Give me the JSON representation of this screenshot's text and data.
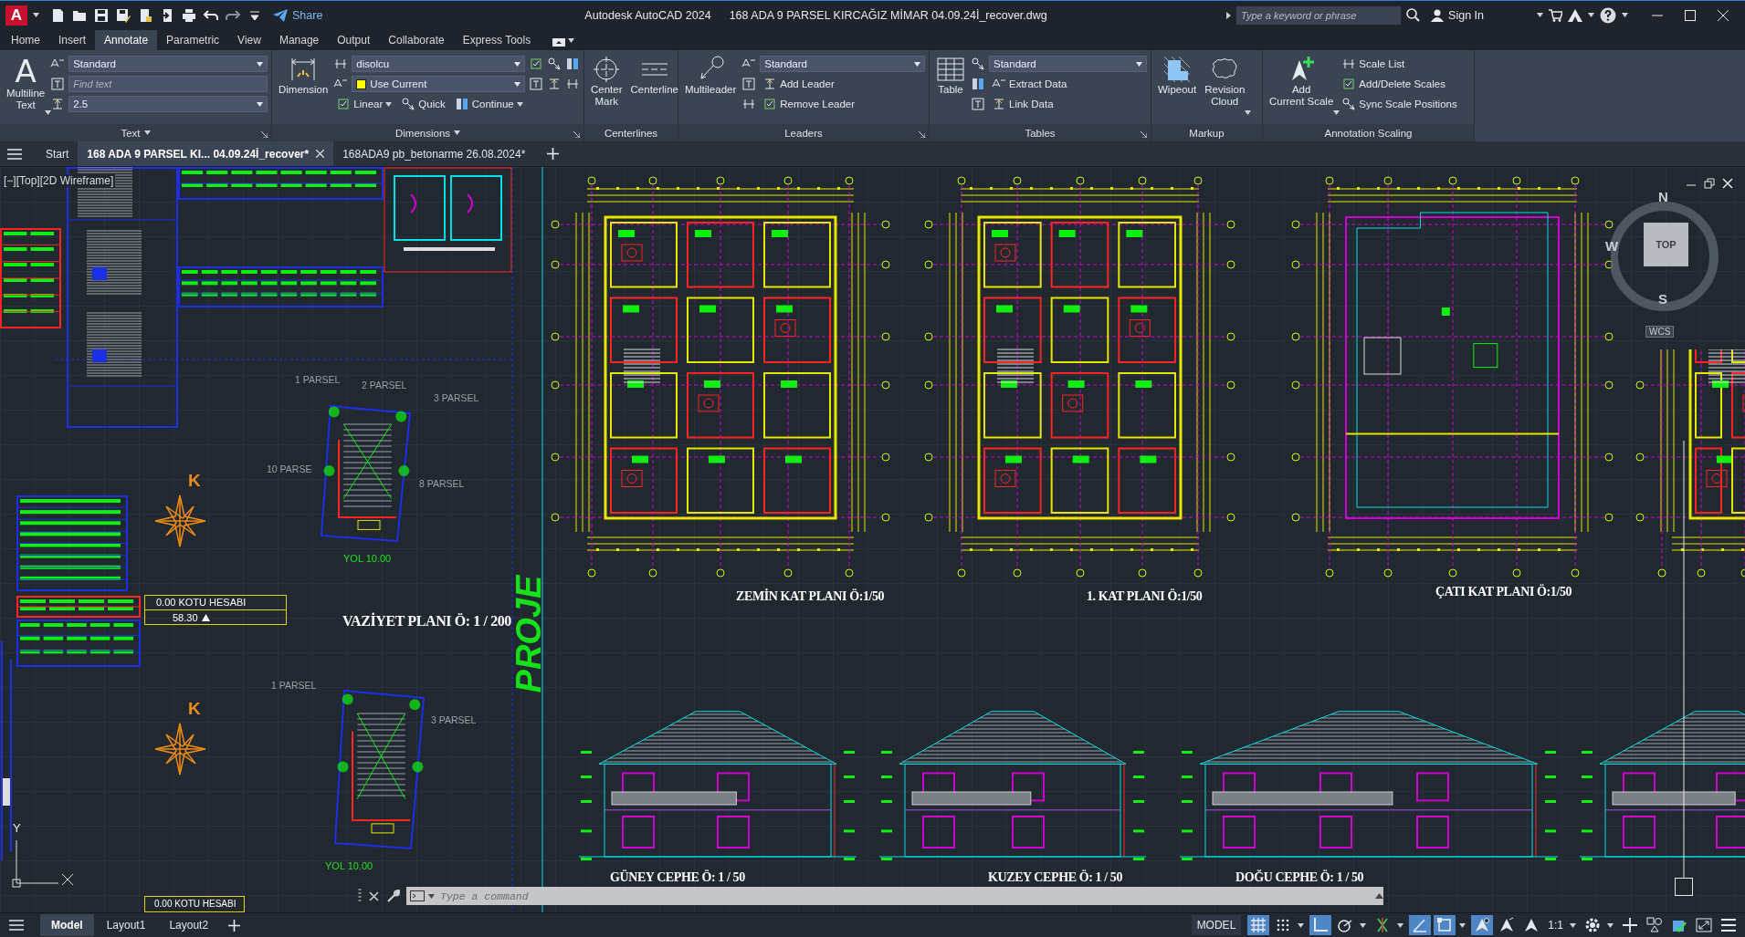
{
  "title_bar": {
    "app_logo": "A",
    "share": "Share",
    "app_name": "Autodesk AutoCAD 2024",
    "file_name": "168 ADA 9 PARSEL KIRCAĞIZ MİMAR 04.09.24İ_recover.dwg",
    "search_placeholder": "Type a keyword or phrase",
    "sign_in": "Sign In"
  },
  "ribbon_tabs": [
    {
      "label": "Home",
      "selected": false
    },
    {
      "label": "Insert",
      "selected": false
    },
    {
      "label": "Annotate",
      "selected": true
    },
    {
      "label": "Parametric",
      "selected": false
    },
    {
      "label": "View",
      "selected": false
    },
    {
      "label": "Manage",
      "selected": false
    },
    {
      "label": "Output",
      "selected": false
    },
    {
      "label": "Collaborate",
      "selected": false
    },
    {
      "label": "Express Tools",
      "selected": false
    }
  ],
  "ribbon_panels": [
    {
      "title": "Text",
      "title_caret": true,
      "launcher": true,
      "large": [
        {
          "glyph": "A",
          "label": "Multiline\nText",
          "caret": true
        }
      ],
      "rows": [
        {
          "kind": "dropdown",
          "value": "Standard"
        },
        {
          "kind": "search",
          "placeholder": "Find text"
        },
        {
          "kind": "dropdown",
          "value": "2.5"
        }
      ]
    },
    {
      "title": "Dimensions",
      "title_caret": true,
      "launcher": true,
      "large": [
        {
          "label": "Dimension",
          "caret": false
        }
      ],
      "rows": [
        {
          "kind": "dropdown_tools",
          "value": "disolcu"
        },
        {
          "kind": "dropdown_tools",
          "value": "Use Current",
          "color": "#ffff00"
        },
        {
          "kind": "tools",
          "items": [
            {
              "label": "Linear",
              "caret": true
            },
            {
              "label": "Quick",
              "caret": false
            },
            {
              "label": "Continue",
              "caret": true
            }
          ]
        }
      ]
    },
    {
      "title": "Centerlines",
      "title_caret": false,
      "launcher": false,
      "large": [
        {
          "label": "Center\nMark",
          "caret": false
        },
        {
          "label": "Centerline",
          "caret": false
        }
      ]
    },
    {
      "title": "Leaders",
      "title_caret": false,
      "launcher": true,
      "large": [
        {
          "label": "Multileader",
          "caret": false
        }
      ],
      "rows": [
        {
          "kind": "dropdown",
          "value": "Standard"
        },
        {
          "kind": "tools",
          "items": [
            {
              "label": "Add Leader",
              "caret": false
            }
          ]
        },
        {
          "kind": "tools",
          "items": [
            {
              "label": "Remove Leader",
              "caret": false
            }
          ]
        }
      ]
    },
    {
      "title": "Tables",
      "title_caret": false,
      "launcher": true,
      "large": [
        {
          "label": "Table",
          "caret": false
        }
      ],
      "rows": [
        {
          "kind": "dropdown",
          "value": "Standard"
        },
        {
          "kind": "tools",
          "items": [
            {
              "label": "Extract Data",
              "caret": false
            }
          ]
        },
        {
          "kind": "tools",
          "items": [
            {
              "label": "Link Data",
              "caret": false
            }
          ]
        }
      ]
    },
    {
      "title": "Markup",
      "title_caret": false,
      "launcher": false,
      "large": [
        {
          "label": "Wipeout",
          "caret": false
        },
        {
          "label": "Revision\nCloud",
          "caret": true
        }
      ]
    },
    {
      "title": "Annotation Scaling",
      "title_caret": false,
      "launcher": false,
      "large": [
        {
          "label": "Add\nCurrent Scale",
          "caret": true
        }
      ],
      "rows": [
        {
          "kind": "tools",
          "items": [
            {
              "label": "Scale List",
              "caret": false
            }
          ]
        },
        {
          "kind": "tools",
          "items": [
            {
              "label": "Add/Delete Scales",
              "caret": false
            }
          ]
        },
        {
          "kind": "tools",
          "items": [
            {
              "label": "Sync Scale Positions",
              "caret": false
            }
          ]
        }
      ]
    }
  ],
  "file_tabs": {
    "start": "Start",
    "tabs": [
      {
        "label": "168 ADA 9 PARSEL KI... 04.09.24İ_recover*",
        "selected": true
      },
      {
        "label": "168ADA9 pb_betonarme 26.08.2024*",
        "selected": false
      }
    ]
  },
  "drawing": {
    "viewport_label": "[−][Top][2D Wireframe]",
    "site_plans": [
      {
        "parcels": [
          "1 PARSEL",
          "2 PARSEL",
          "3 PARSEL",
          "10 PARSE",
          "8 PARSEL"
        ],
        "road": "YOL  10.00",
        "north": "K",
        "elevation_box": {
          "title": "0.00 KOTU HESABI",
          "value": "58.30"
        },
        "title": "VAZİYET PLANI Ö: 1 / 200"
      },
      {
        "parcels": [
          "1 PARSEL",
          "3 PARSEL"
        ],
        "road": "YOL  10.00",
        "north": "K"
      }
    ],
    "bottom_box": "0.00 KOTU HESABI",
    "vertical_title": "PROJE",
    "floor_plans": [
      {
        "title": "ZEMİN KAT PLANI Ö:1/50",
        "kind": "floor"
      },
      {
        "title": "1. KAT PLANI Ö:1/50",
        "kind": "floor"
      },
      {
        "title": "ÇATI KAT PLANI Ö:1/50",
        "kind": "roof"
      }
    ],
    "elevations": [
      {
        "title": "GÜNEY CEPHE Ö: 1 / 50"
      },
      {
        "title": "KUZEY CEPHE Ö: 1 / 50"
      },
      {
        "title": "DOĞU CEPHE Ö: 1 / 50"
      }
    ],
    "viewcube": {
      "north": "N",
      "west": "W",
      "south": "S",
      "face": "TOP",
      "ucs": "WCS"
    },
    "ucs_axis": "Y"
  },
  "command_line": {
    "placeholder": "Type a command"
  },
  "layout_tabs": [
    {
      "label": "Model",
      "selected": true
    },
    {
      "label": "Layout1",
      "selected": false
    },
    {
      "label": "Layout2",
      "selected": false
    }
  ],
  "status_bar": {
    "model": "MODEL",
    "tools": [
      {
        "on": true,
        "caret": false
      },
      {
        "on": false,
        "caret": true
      },
      {
        "on": true,
        "caret": false
      },
      {
        "on": false,
        "caret": true
      },
      {
        "on": false,
        "caret": true
      },
      {
        "on": true,
        "caret": false
      },
      {
        "on": true,
        "caret": true
      },
      {
        "on": true,
        "caret": false
      },
      {
        "on": false,
        "caret": false
      },
      {
        "on": false,
        "caret": false
      },
      {
        "on": false,
        "caret": true,
        "label": "1:1"
      },
      {
        "on": false,
        "caret": true
      },
      {
        "on": false,
        "caret": false
      },
      {
        "on": false,
        "caret": false
      },
      {
        "on": false,
        "caret": false
      },
      {
        "on": false,
        "caret": false
      },
      {
        "on": false,
        "caret": false
      }
    ]
  }
}
